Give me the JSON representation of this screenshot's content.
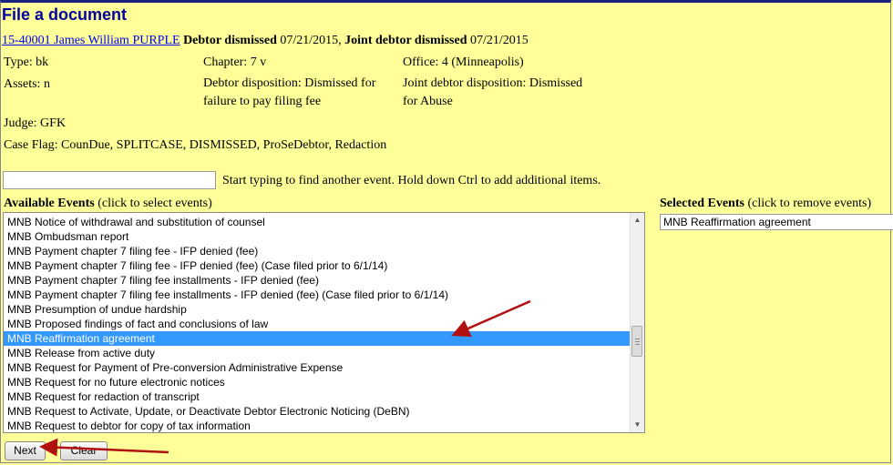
{
  "page": {
    "title": "File a document"
  },
  "case": {
    "link_text": "15-40001 James William PURPLE",
    "debtor_status_label": "Debtor dismissed",
    "debtor_status_date": "07/21/2015,",
    "joint_status_label": "Joint debtor dismissed",
    "joint_status_date": "07/21/2015"
  },
  "info": {
    "type": "Type: bk",
    "chapter": "Chapter: 7 v",
    "office": "Office: 4 (Minneapolis)",
    "assets": "Assets: n",
    "debtor_disposition": "Debtor disposition: Dismissed for failure to pay filing fee",
    "joint_disposition": "Joint debtor disposition: Dismissed for Abuse",
    "judge": "Judge: GFK",
    "case_flag": "Case Flag: CounDue, SPLITCASE, DISMISSED, ProSeDebtor, Redaction"
  },
  "search": {
    "value": "",
    "hint": "Start typing to find another event. Hold down Ctrl to add additional items."
  },
  "available": {
    "heading_bold": "Available Events",
    "heading_note": "(click to select events)",
    "items": [
      "MNB Notice of withdrawal and substitution of counsel",
      "MNB Ombudsman report",
      "MNB Payment chapter 7 filing fee - IFP denied (fee)",
      "MNB Payment chapter 7 filing fee - IFP denied (fee) (Case filed prior to 6/1/14)",
      "MNB Payment chapter 7 filing fee installments - IFP denied (fee)",
      "MNB Payment chapter 7 filing fee installments - IFP denied (fee) (Case filed prior to 6/1/14)",
      "MNB Presumption of undue hardship",
      "MNB Proposed findings of fact and conclusions of law",
      "MNB Reaffirmation agreement",
      "MNB Release from active duty",
      "MNB Request for Payment of Pre-conversion Administrative Expense",
      "MNB Request for no future electronic notices",
      "MNB Request for redaction of transcript",
      "MNB Request to Activate, Update, or Deactivate Debtor Electronic Noticing (DeBN)",
      "MNB Request to debtor for copy of tax information"
    ],
    "selected_index": 8
  },
  "selected": {
    "heading_bold": "Selected Events",
    "heading_note": "(click to remove events)",
    "items": [
      "MNB Reaffirmation agreement"
    ]
  },
  "buttons": {
    "next": "Next",
    "clear": "Clear"
  },
  "colors": {
    "background": "#ffff99",
    "title": "#0000a0",
    "highlight": "#3399ff",
    "arrow": "#b01010"
  },
  "icons": {
    "scroll_up": "triangle-up",
    "scroll_down": "triangle-down",
    "arrow": "red-arrow"
  }
}
